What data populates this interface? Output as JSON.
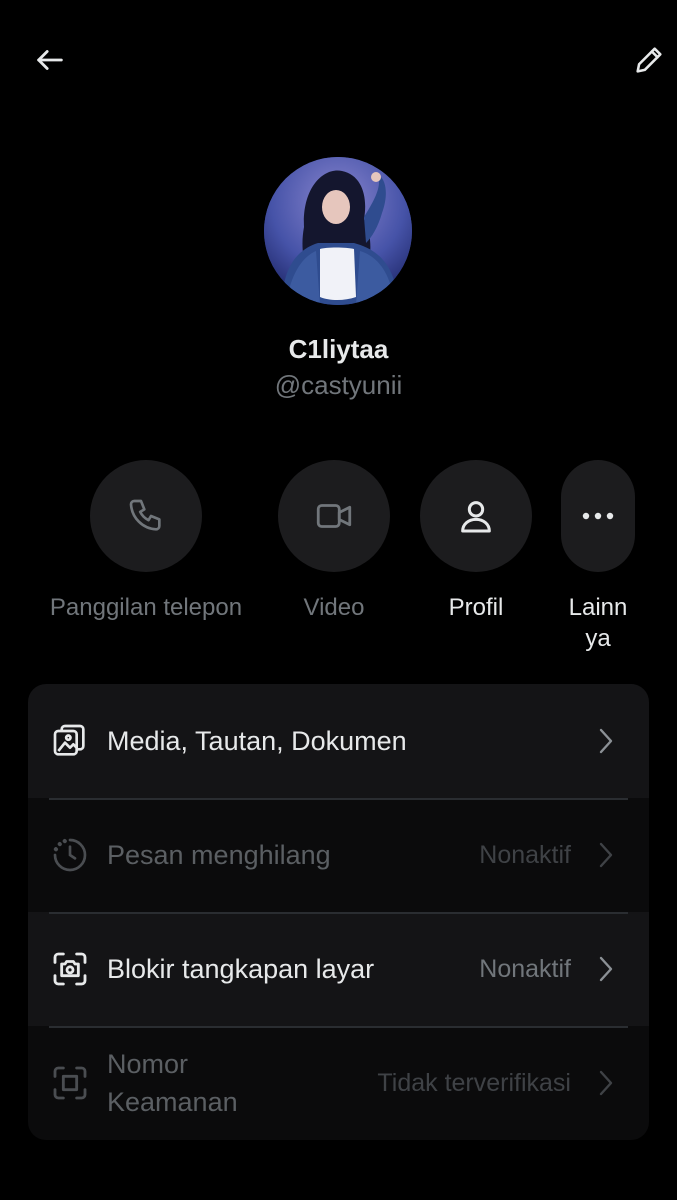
{
  "profile": {
    "display_name": "C1liytaa",
    "handle": "@castyunii"
  },
  "actions": [
    {
      "label": "Panggilan telepon",
      "icon": "phone-icon",
      "enabled": false
    },
    {
      "label": "Video",
      "icon": "video-icon",
      "enabled": false
    },
    {
      "label": "Profil",
      "icon": "person-icon",
      "enabled": true
    },
    {
      "label": "Lainn ya",
      "icon": "more-icon",
      "enabled": true
    }
  ],
  "settings": [
    {
      "label": "Media, Tautan, Dokumen",
      "value": "",
      "icon": "media-icon",
      "enabled": true
    },
    {
      "label": "Pesan menghilang",
      "value": "Nonaktif",
      "icon": "timer-icon",
      "enabled": false
    },
    {
      "label": "Blokir tangkapan layar",
      "value": "Nonaktif",
      "icon": "screenshot-block-icon",
      "enabled": true
    },
    {
      "label": "Nomor Keamanan",
      "value": "Tidak terverifikasi",
      "icon": "security-number-icon",
      "enabled": false
    }
  ],
  "colors": {
    "background": "#000000",
    "text_primary": "#e7e9ea",
    "text_secondary": "#71767b",
    "button_bg": "#1c1c1e",
    "card_bg": "#141416"
  },
  "icons": {
    "back": "arrow-left-icon",
    "edit": "pencil-icon"
  }
}
